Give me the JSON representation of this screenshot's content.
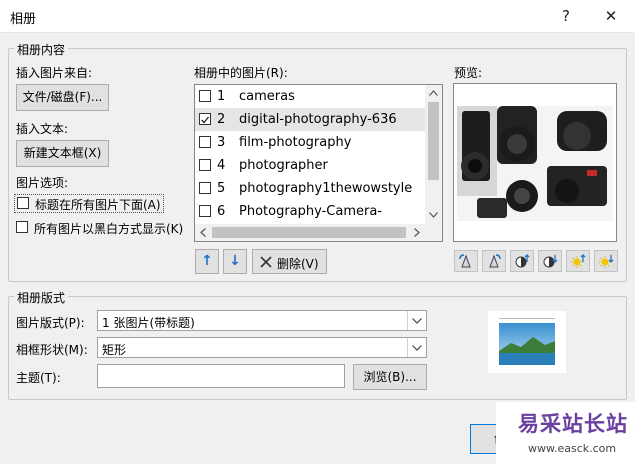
{
  "window": {
    "title": "相册",
    "help": "?",
    "close": "✕"
  },
  "album_content": {
    "group_label": "相册内容",
    "insert_from_label": "插入图片来自:",
    "file_disk_button": "文件/磁盘(F)...",
    "insert_text_label": "插入文本:",
    "new_textbox_button": "新建文本框(X)",
    "picture_options_label": "图片选项:",
    "caption_below_label": "标题在所有图片下面(A)",
    "black_white_label": "所有图片以黑白方式显示(K)"
  },
  "pictures_list": {
    "label": "相册中的图片(R):",
    "items": [
      {
        "num": "1",
        "name": "cameras",
        "checked": false
      },
      {
        "num": "2",
        "name": "digital-photography-636",
        "checked": true
      },
      {
        "num": "3",
        "name": "film-photography",
        "checked": false
      },
      {
        "num": "4",
        "name": "photographer",
        "checked": false
      },
      {
        "num": "5",
        "name": "photography1thewowstyle",
        "checked": false
      },
      {
        "num": "6",
        "name": "Photography-Camera-",
        "checked": false
      }
    ],
    "move_up": "↑",
    "move_down": "↓",
    "delete_button": "删除(V)"
  },
  "preview": {
    "label": "预览:"
  },
  "album_layout": {
    "group_label": "相册版式",
    "picture_layout_label": "图片版式(P):",
    "picture_layout_value": "1 张图片(带标题)",
    "frame_shape_label": "相框形状(M):",
    "frame_shape_value": "矩形",
    "theme_label": "主题(T):",
    "theme_value": "",
    "browse_button": "浏览(B)..."
  },
  "footer": {
    "create_button": "创建"
  },
  "watermark": {
    "title": "易采站长站",
    "url": "www.easck.com"
  }
}
